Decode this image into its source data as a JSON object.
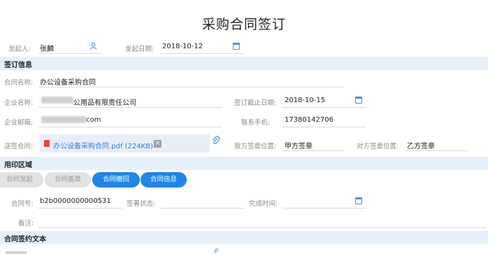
{
  "page_title": "采购合同签订",
  "initiator": {
    "label": "发起人:",
    "value": "张麟"
  },
  "start_date": {
    "label": "发起日期:",
    "value": "2018-10-12"
  },
  "section_sign": "签订信息",
  "contract_name": {
    "label": "合同名称:",
    "value": "办公设备采购合同"
  },
  "company_name": {
    "label": "企业名称:",
    "value": "公用品有限责任公司"
  },
  "deadline": {
    "label": "签订截止日期:",
    "value": "2018-10-15"
  },
  "company_email": {
    "label": "企业邮箱:",
    "value": "com"
  },
  "phone": {
    "label": "联系手机:",
    "value": "17380142706"
  },
  "send_contract": {
    "label": "送签合同:",
    "file": "办公设备采购合同.pdf (224KB)"
  },
  "our_stamp": {
    "label": "我方签章位置:",
    "value": "甲方签章"
  },
  "their_stamp": {
    "label": "对方签章位置:",
    "value": "乙方签章"
  },
  "section_seal": "用印区域",
  "tabs": [
    {
      "label": "合同发起",
      "active": false
    },
    {
      "label": "合同盖章",
      "active": false
    },
    {
      "label": "合同撤回",
      "active": true
    },
    {
      "label": "合同信息",
      "active": true
    }
  ],
  "contract_no": {
    "label": "合同号:",
    "value": "b2b0000000000531"
  },
  "sign_status": {
    "label": "签署状态:",
    "value": ""
  },
  "finish_time": {
    "label": "完成时间:",
    "value": ""
  },
  "remark": {
    "label": "备注:",
    "value": ""
  },
  "section_text": "合同签约文本",
  "colors": {
    "accent": "#1f86e6",
    "section_bg": "#e6f0fb",
    "tab_gray": "#e2e2e2"
  },
  "icons": [
    "user-icon",
    "calendar-icon",
    "pdf-icon",
    "close-icon",
    "paperclip-icon"
  ]
}
